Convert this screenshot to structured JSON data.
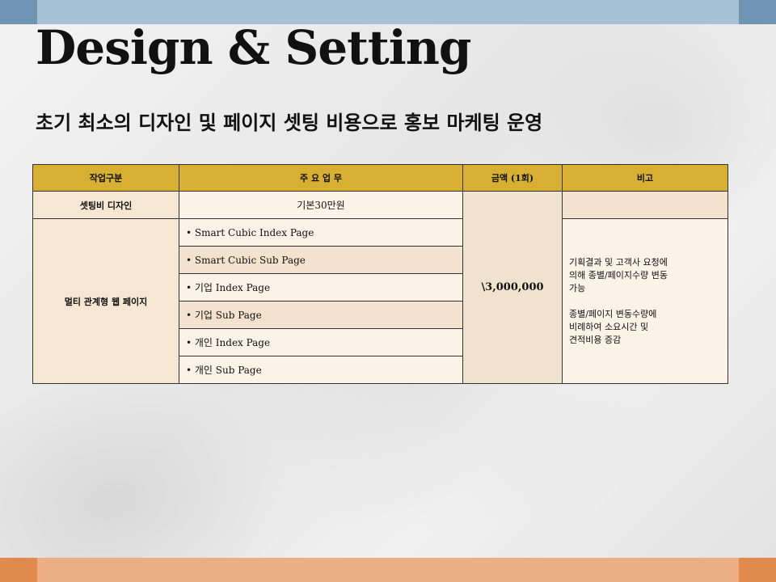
{
  "slide": {
    "title": "Design & Setting",
    "subtitle": "초기 최소의 디자인 및 페이지 셋팅 비용으로 홍보 마케팅 운영"
  },
  "table": {
    "headers": [
      "작업구분",
      "주 요 업 무",
      "금액 (1회)",
      "비고"
    ],
    "rows": [
      {
        "category": "셋팅비 디자인",
        "task": "기본30만원"
      },
      {
        "category": "멀티 관계형 웹 페이지",
        "tasks": [
          "• Smart Cubic Index Page",
          "• Smart Cubic Sub Page",
          "• 기업 Index Page",
          "• 기업 Sub Page",
          "• 개인 Index Page",
          "• 개인 Sub Page"
        ]
      }
    ],
    "amount": "\\3,000,000",
    "note_lines": [
      "기획결과 및 고객사 요청에",
      "의해 종별/페이지수량 변동",
      "가능",
      "",
      "종별/페이지 변동수량에",
      "비례하여 소요시간 및",
      "견적비용 증감"
    ]
  },
  "colors": {
    "header_bg": "#d6af33",
    "top_band": "#a6c0d4",
    "bottom_band": "#ecae84"
  }
}
